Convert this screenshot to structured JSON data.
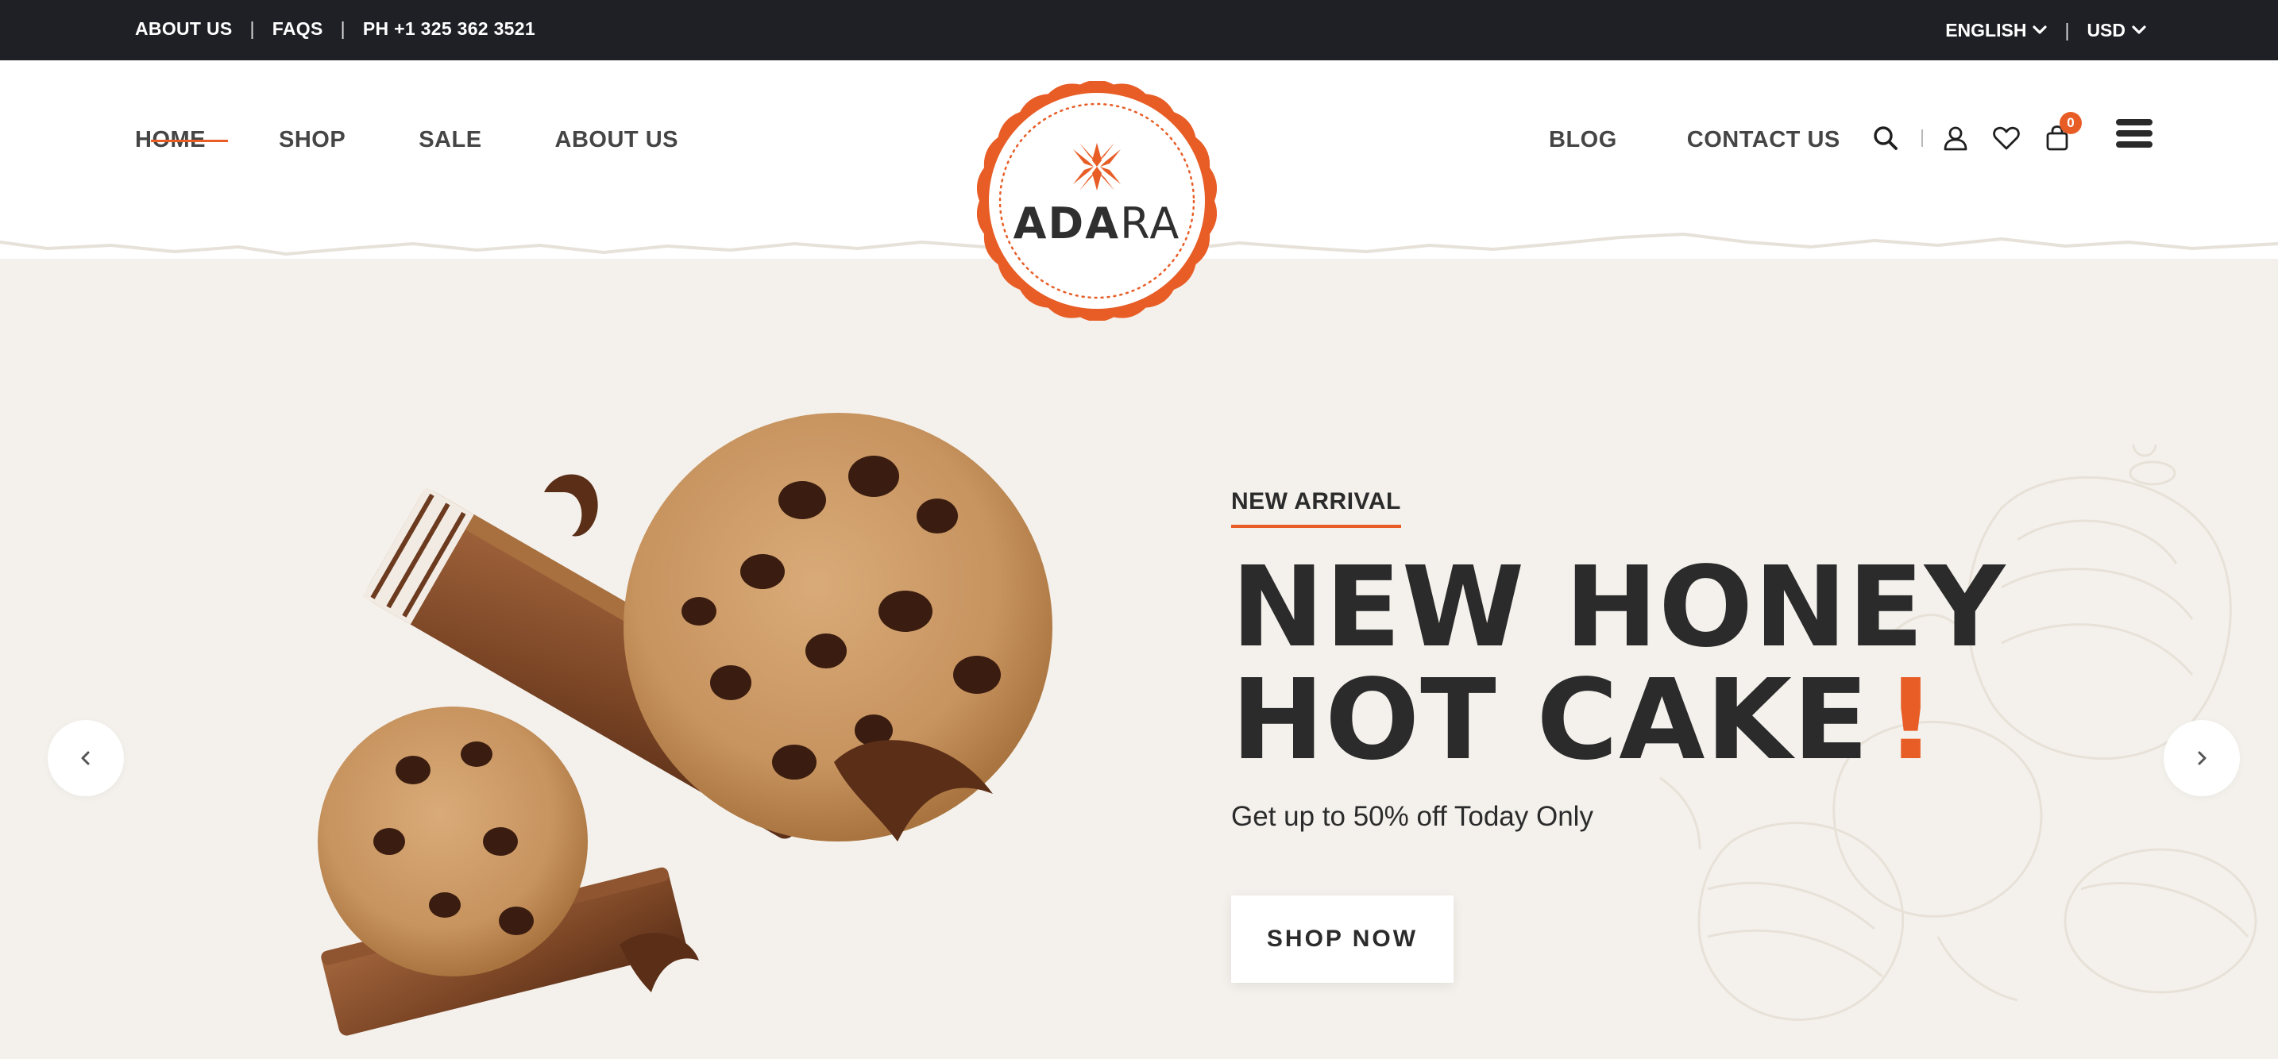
{
  "topbar": {
    "links": [
      "ABOUT US",
      "FAQS",
      "PH +1 325 362 3521"
    ],
    "separator": "|",
    "language": "ENGLISH",
    "currency": "USD"
  },
  "nav": {
    "left": [
      "HOME",
      "SHOP",
      "SALE",
      "ABOUT US"
    ],
    "right": [
      "BLOG",
      "CONTACT US"
    ],
    "active": "HOME"
  },
  "logo": {
    "bold": "ADA",
    "light": "RA"
  },
  "header_icons": [
    "search-icon",
    "user-icon",
    "heart-icon",
    "shopping-bag-icon",
    "menu-icon"
  ],
  "cart": {
    "count": "0"
  },
  "hero": {
    "eyebrow": "NEW ARRIVAL",
    "title_line1": "NEW HONEY",
    "title_line2": "HOT CAKE",
    "title_mark": "!",
    "subtitle": "Get up to 50% off Today Only",
    "cta": "SHOP NOW"
  },
  "colors": {
    "accent": "#e85d26",
    "dark": "#1f1f26",
    "hero_bg": "#f4f1ec",
    "text": "#2b2b2b"
  }
}
